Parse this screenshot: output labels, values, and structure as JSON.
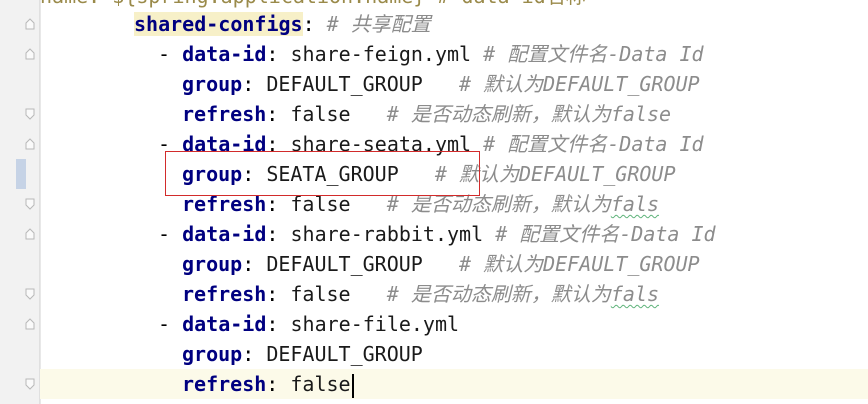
{
  "editor": {
    "language": "yaml",
    "partial_top_line": "name: ${spring.application.name} # data-id名称",
    "lines": [
      {
        "indent": 0,
        "key": "shared-configs",
        "sep": ":",
        "value": "",
        "comment": "# 共享配置",
        "highlight_key": true
      },
      {
        "indent": 1,
        "dash": "- ",
        "key": "data-id",
        "sep": ":",
        "value": "share-feign.yml",
        "comment": "# 配置文件名-Data Id"
      },
      {
        "indent": 2,
        "key": "group",
        "sep": ":",
        "value": "DEFAULT_GROUP",
        "gap": "   ",
        "comment": "# 默认为DEFAULT_GROUP"
      },
      {
        "indent": 2,
        "key": "refresh",
        "sep": ":",
        "value": "false",
        "gap": "   ",
        "comment": "# 是否动态刷新，默认为false"
      },
      {
        "indent": 1,
        "dash": "- ",
        "key": "data-id",
        "sep": ":",
        "value": "share-seata.yml",
        "comment": "# 配置文件名-Data Id"
      },
      {
        "indent": 2,
        "key": "group",
        "sep": ":",
        "value": "SEATA_GROUP",
        "gap": "   ",
        "comment": "# 默认为DEFAULT_GROUP"
      },
      {
        "indent": 2,
        "key": "refresh",
        "sep": ":",
        "value": "false",
        "gap": "   ",
        "comment": "# 是否动态刷新，默认为fals",
        "squiggle_tail": "fals"
      },
      {
        "indent": 1,
        "dash": "- ",
        "key": "data-id",
        "sep": ":",
        "value": "share-rabbit.yml",
        "comment": "# 配置文件名-Data Id"
      },
      {
        "indent": 2,
        "key": "group",
        "sep": ":",
        "value": "DEFAULT_GROUP",
        "gap": "   ",
        "comment": "# 默认为DEFAULT_GROUP"
      },
      {
        "indent": 2,
        "key": "refresh",
        "sep": ":",
        "value": "false",
        "gap": "   ",
        "comment": "# 是否动态刷新，默认为fals",
        "squiggle_tail": "fals"
      },
      {
        "indent": 1,
        "dash": "- ",
        "key": "data-id",
        "sep": ":",
        "value": "share-file.yml",
        "comment": ""
      },
      {
        "indent": 2,
        "key": "group",
        "sep": ":",
        "value": "DEFAULT_GROUP",
        "comment": ""
      },
      {
        "indent": 2,
        "key": "refresh",
        "sep": ":",
        "value": "false",
        "comment": "",
        "caret": true
      }
    ]
  },
  "colors": {
    "key": "#000080",
    "comment": "#8c8c8c",
    "annotation_box": "#d22b2b",
    "caret_line": "#fcfae9"
  },
  "gutter": {
    "fold_icon": "fold-arrow-icon",
    "change_marker": "modified-line-marker"
  }
}
